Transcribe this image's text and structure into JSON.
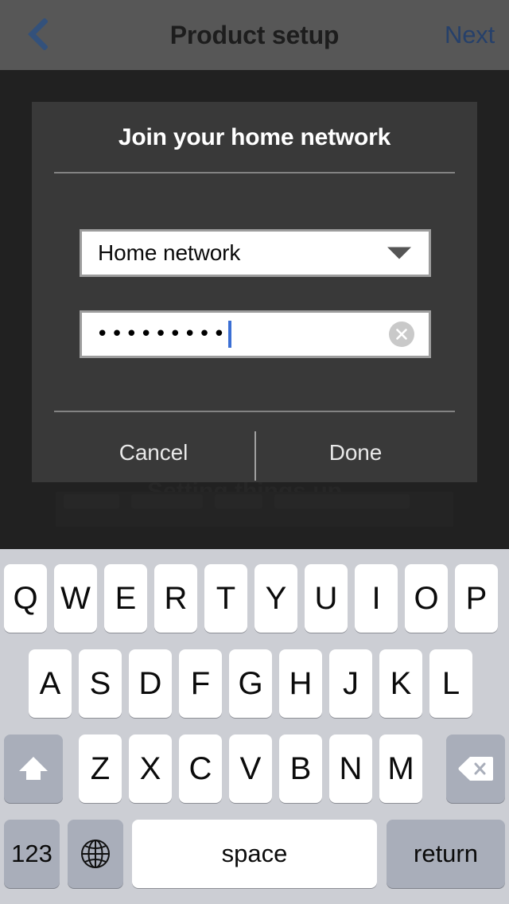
{
  "navbar": {
    "back_icon": "chevron-left-icon",
    "title": "Product setup",
    "next_label": "Next"
  },
  "backdrop": {
    "ghost_title": "Setting things up..."
  },
  "dialog": {
    "title": "Join your home network",
    "network_select": {
      "value": "Home network",
      "caret_icon": "chevron-down-icon"
    },
    "password_field": {
      "value": "•••••••••",
      "masked_char_count": 9,
      "clear_icon": "clear-circle-icon"
    },
    "cancel_label": "Cancel",
    "done_label": "Done"
  },
  "keyboard": {
    "row1": [
      "Q",
      "W",
      "E",
      "R",
      "T",
      "Y",
      "U",
      "I",
      "O",
      "P"
    ],
    "row2": [
      "A",
      "S",
      "D",
      "F",
      "G",
      "H",
      "J",
      "K",
      "L"
    ],
    "row3": [
      "Z",
      "X",
      "C",
      "V",
      "B",
      "N",
      "M"
    ],
    "shift_icon": "shift-arrow-icon",
    "backspace_icon": "backspace-icon",
    "numbers_label": "123",
    "globe_icon": "globe-icon",
    "space_label": "space",
    "return_label": "return"
  },
  "colors": {
    "navbar_bg": "#575757",
    "accent_blue": "#26406a",
    "dialog_bg": "#393939",
    "page_bg": "#212121",
    "keyboard_bg": "#ccced4",
    "key_bg": "#ffffff",
    "key_dark_bg": "#a9aeba",
    "caret_blue": "#3b6fd4"
  }
}
